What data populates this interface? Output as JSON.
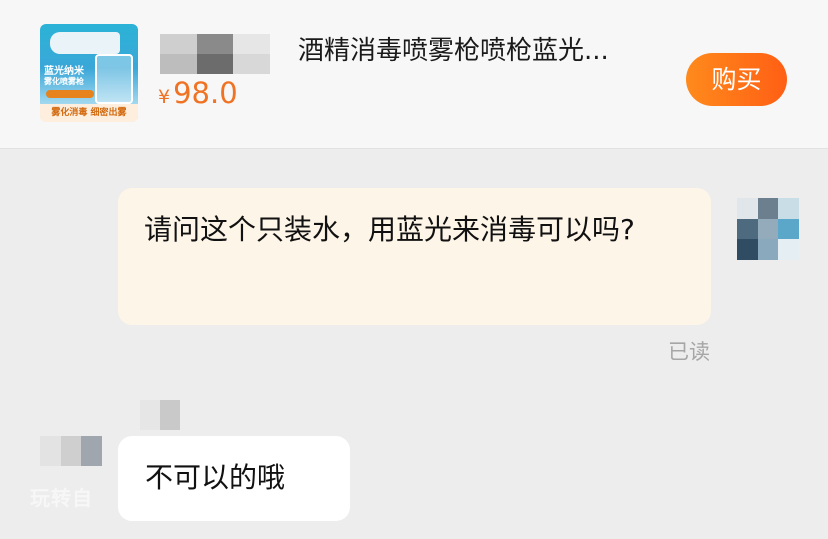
{
  "product": {
    "thumbnail": {
      "line1": "蓝光纳米",
      "line2": "雾化喷雾枪",
      "footer": "雾化消毒 细密出雾"
    },
    "title": "酒精消毒喷雾枪喷枪蓝光...",
    "currency": "¥",
    "price": "98.0",
    "buy_label": "购买"
  },
  "messages": [
    {
      "from": "me",
      "text": "请问这个只装水，用蓝光来消毒可以吗?",
      "status": "已读"
    },
    {
      "from": "seller",
      "text": "不可以的哦"
    }
  ],
  "watermark": "玩转自",
  "colors": {
    "accent": "#f07223",
    "buy_button": "#ff6a17",
    "my_bubble": "#fdf5e8",
    "their_bubble": "#ffffff",
    "background": "#ededed"
  }
}
